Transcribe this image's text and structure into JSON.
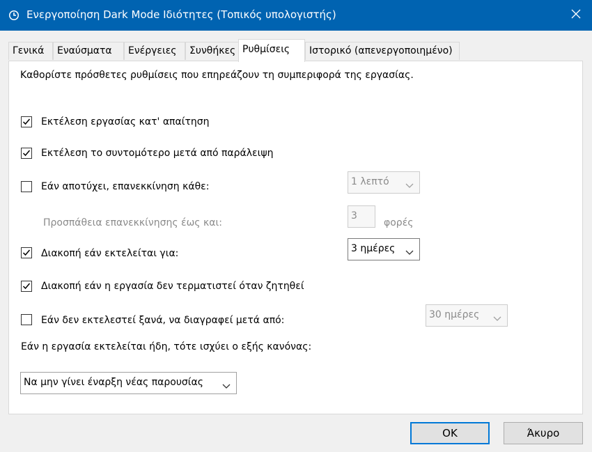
{
  "window": {
    "title": "Ενεργοποίηση Dark Mode Ιδιότητες (Τοπικός υπολογιστής)"
  },
  "tabs": [
    {
      "label": "Γενικά"
    },
    {
      "label": "Εναύσματα"
    },
    {
      "label": "Ενέργειες"
    },
    {
      "label": "Συνθήκες"
    },
    {
      "label": "Ρυθμίσεις",
      "active": true
    },
    {
      "label": "Ιστορικό (απενεργοποιημένο)"
    }
  ],
  "settings": {
    "intro": "Καθορίστε πρόσθετες ρυθμίσεις που επηρεάζουν τη συμπεριφορά της εργασίας.",
    "run_on_demand": {
      "label": "Εκτέλεση εργασίας κατ' απαίτηση",
      "checked": true
    },
    "run_asap": {
      "label": "Εκτέλεση το συντομότερο μετά από παράλειψη",
      "checked": true
    },
    "restart_on_fail": {
      "label": "Εάν αποτύχει, επανεκκίνηση κάθε:",
      "checked": false,
      "interval": "1 λεπτό"
    },
    "restart_attempts": {
      "label": "Προσπάθεια επανεκκίνησης έως και:",
      "value": "3",
      "unit": "φορές"
    },
    "stop_if_runs": {
      "label": "Διακοπή εάν εκτελείται για:",
      "checked": true,
      "duration": "3 ημέρες"
    },
    "force_stop": {
      "label": "Διακοπή εάν η εργασία δεν τερματιστεί όταν ζητηθεί",
      "checked": true
    },
    "delete_if_not_scheduled": {
      "label": "Εάν δεν εκτελεστεί ξανά, να διαγραφεί μετά από:",
      "checked": false,
      "duration": "30 ημέρες"
    },
    "rule_label": "Εάν η εργασία εκτελείται ήδη, τότε ισχύει ο εξής κανόνας:",
    "rule_value": "Να μην γίνει έναρξη νέας παρουσίας"
  },
  "buttons": {
    "ok": "OK",
    "cancel": "Άκυρο"
  },
  "colors": {
    "titlebar": "#0063b1",
    "focus": "#0078d7"
  }
}
